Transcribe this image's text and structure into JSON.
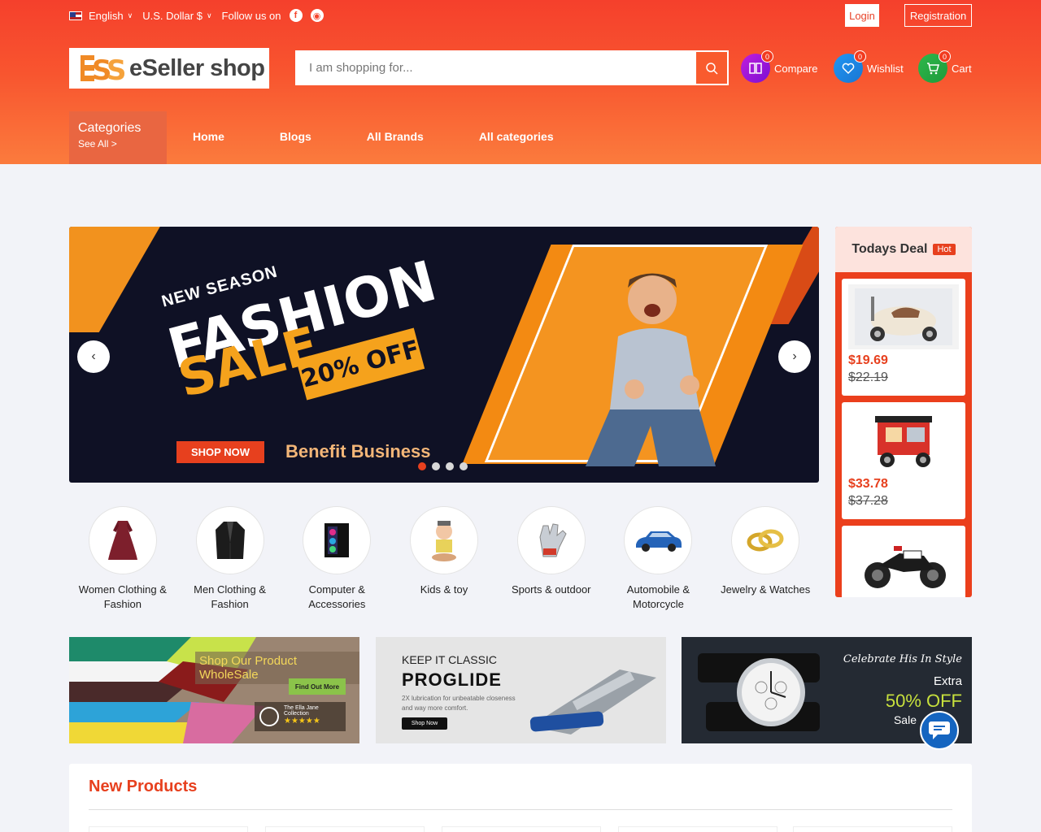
{
  "topbar": {
    "language": "English",
    "currency": "U.S. Dollar $",
    "follow_label": "Follow us on",
    "login": "Login",
    "registration": "Registration"
  },
  "logo": {
    "mark": "ESS",
    "brand": "eSeller shop"
  },
  "search": {
    "placeholder": "I am shopping for..."
  },
  "header_icons": {
    "compare": {
      "label": "Compare",
      "count": "0"
    },
    "wishlist": {
      "label": "Wishlist",
      "count": "0"
    },
    "cart": {
      "label": "Cart",
      "count": "0"
    }
  },
  "categories_box": {
    "title": "Categories",
    "see_all": "See All >"
  },
  "nav": [
    "Home",
    "Blogs",
    "All Brands",
    "All categories"
  ],
  "slider": {
    "line1": "NEW SEASON",
    "line2": "FASHION",
    "line3": "SALE",
    "discount": "20% OFF",
    "cta": "SHOP NOW",
    "tagline": "Benefit Business",
    "dots": 4,
    "active_dot": 1
  },
  "todays_deal": {
    "title": "Todays Deal",
    "badge": "Hot",
    "items": [
      {
        "price": "$19.69",
        "old_price": "$22.19"
      },
      {
        "price": "$33.78",
        "old_price": "$37.28"
      },
      {
        "price": "",
        "old_price": ""
      }
    ]
  },
  "category_list": [
    {
      "name": "Women Clothing & Fashion"
    },
    {
      "name": "Men Clothing & Fashion"
    },
    {
      "name": "Computer & Accessories"
    },
    {
      "name": "Kids & toy"
    },
    {
      "name": "Sports & outdoor"
    },
    {
      "name": "Automobile & Motorcycle"
    },
    {
      "name": "Jewelry & Watches"
    }
  ],
  "banners": {
    "b1": {
      "title": "Shop Our Product WholeSale",
      "cta": "Find Out More",
      "brand": "The Ella Jane Collection",
      "stars": "★★★★★"
    },
    "b2": {
      "kicker": "KEEP IT CLASSIC",
      "title": "PROGLIDE",
      "text1": "2X lubrication for unbeatable closeness",
      "text2": "and way more comfort.",
      "cta": "Shop Now"
    },
    "b3": {
      "script": "Celebrate His In Style",
      "extra": "Extra",
      "off": "50% OFF",
      "sale": "Sale"
    }
  },
  "new_products": {
    "title": "New Products"
  },
  "colors": {
    "primary": "#f5402c",
    "accent": "#e7401e",
    "deal_bg": "#eb3f1c"
  }
}
